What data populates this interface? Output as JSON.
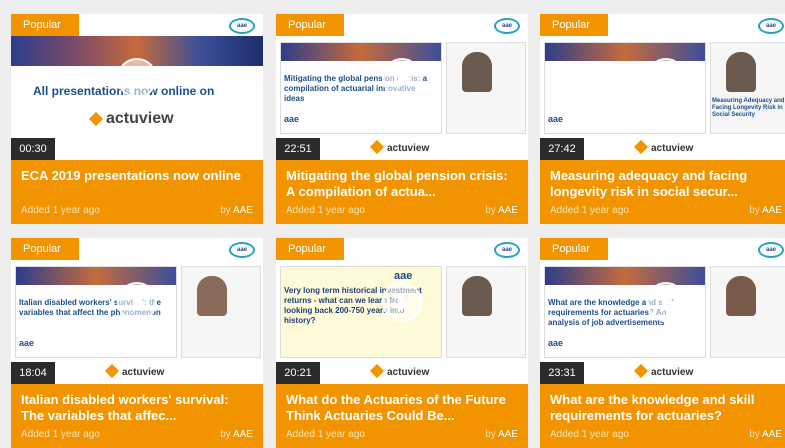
{
  "cards": [
    {
      "badge": "Popular",
      "duration": "00:30",
      "thumb_text": "All presentations now online on",
      "brand": "actuview",
      "title": "ECA 2019 presentations now online",
      "added": "Added 1 year ago",
      "by_prefix": "by",
      "by_author": "AAE"
    },
    {
      "badge": "Popular",
      "duration": "22:51",
      "thumb_text": "Mitigating the global pension crisis: a compilation of actuarial innovative ideas",
      "brand": "actuview",
      "title": "Mitigating the global pension crisis: A compilation of actua...",
      "added": "Added 1 year ago",
      "by_prefix": "by",
      "by_author": "AAE"
    },
    {
      "badge": "Popular",
      "duration": "27:42",
      "thumb_text": "Measuring Adequacy and Facing Longevity Risk in Social Security",
      "brand": "actuview",
      "title": "Measuring adequacy and facing longevity risk in social secur...",
      "added": "Added 1 year ago",
      "by_prefix": "by",
      "by_author": "AAE"
    },
    {
      "badge": "Popular",
      "duration": "18:04",
      "thumb_text": "Italian disabled workers' survival: the variables that affect the phenomenon",
      "brand": "actuview",
      "title": "Italian disabled workers' survival: The variables that affec...",
      "added": "Added 1 year ago",
      "by_prefix": "by",
      "by_author": "AAE"
    },
    {
      "badge": "Popular",
      "duration": "20:21",
      "thumb_text": "Very long term historical investment returns - what can we learn from looking back 200-750 years into history?",
      "brand": "actuview",
      "title": "What do the Actuaries of the Future Think Actuaries Could Be...",
      "added": "Added 1 year ago",
      "by_prefix": "by",
      "by_author": "AAE"
    },
    {
      "badge": "Popular",
      "duration": "23:31",
      "thumb_text": "What are the knowledge and skill requirements for actuaries? An analysis of job advertisements",
      "brand": "actuview",
      "title": "What are the knowledge and skill requirements for actuaries?",
      "added": "Added 1 year ago",
      "by_prefix": "by",
      "by_author": "AAE"
    }
  ],
  "logo_text": "aae",
  "colors": {
    "accent": "#f29400",
    "duration_bg": "#2b2b2b"
  },
  "icons": {
    "play": "play-icon",
    "brand": "actuview-logo-icon"
  }
}
